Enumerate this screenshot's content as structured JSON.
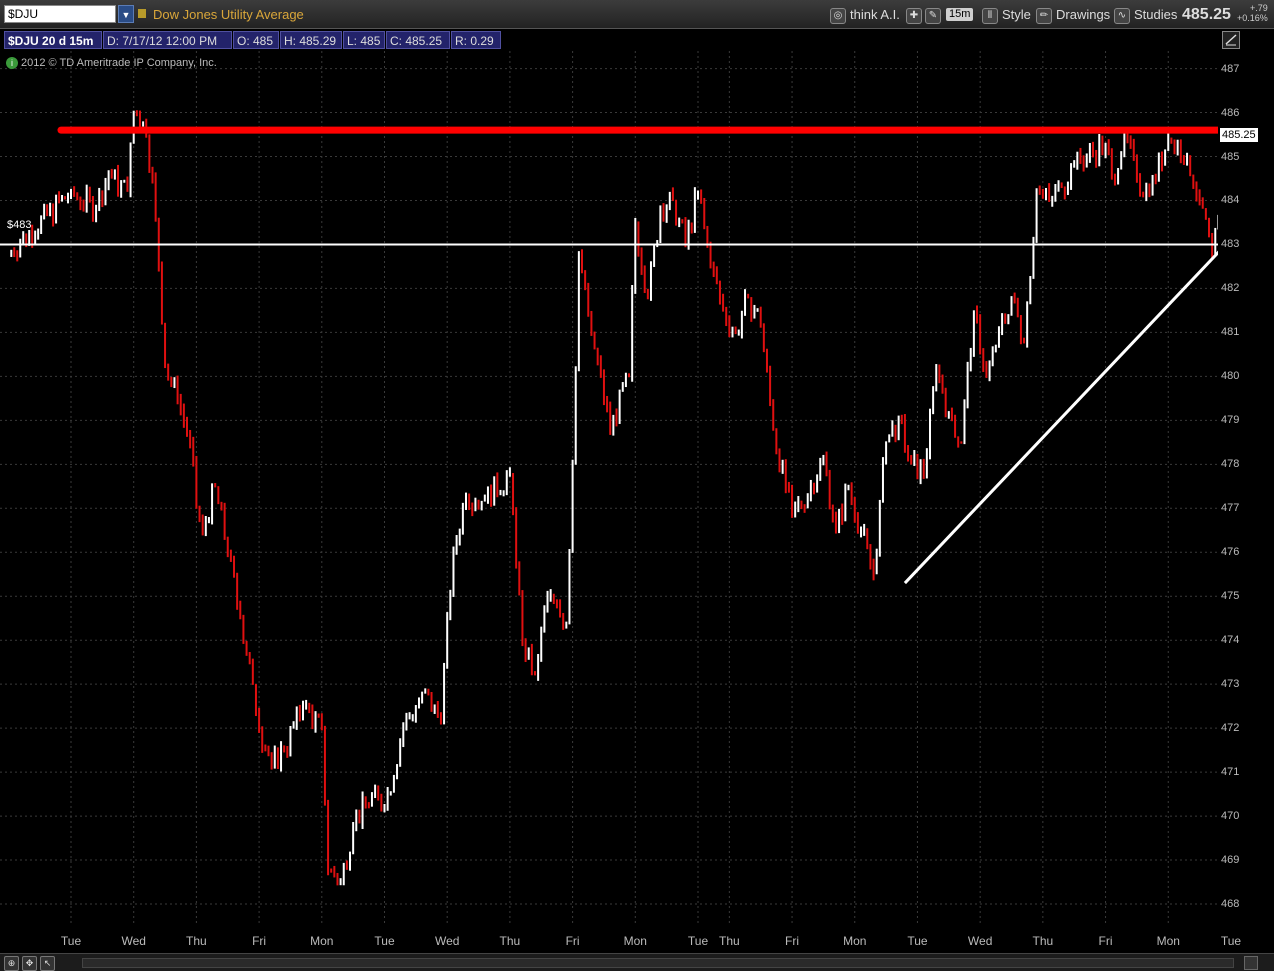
{
  "toolbar": {
    "symbol": "$DJU",
    "symbol_dropdown_icon": "chevron-down-icon",
    "instrument_name": "Dow Jones Utility Average",
    "think_ai": "think A.I.",
    "period": "15m",
    "style_label": "Style",
    "drawings_label": "Drawings",
    "studies_label": "Studies",
    "last_price": "485.25",
    "net_change": "+.79",
    "net_change_pct": "+0.16%"
  },
  "info": {
    "symbol_period": "$DJU 20 d 15m",
    "date": "D: 7/17/12 12:00 PM",
    "open": "O: 485",
    "high": "H: 485.29",
    "low": "L: 485",
    "close": "C: 485.25",
    "range": "R: 0.29"
  },
  "copyright": "2012 © TD Ameritrade IP Company, Inc.",
  "chart_data": {
    "type": "line",
    "interval": "15m",
    "last_price_label": "485.25",
    "horizontal_level_label": "$483",
    "horizontal_level": 483,
    "colors": {
      "up": "#ffffff",
      "down": "#e01010",
      "level": "#ffffff",
      "resistance_arrow": "#ff0000",
      "trendline": "#ffffff",
      "grid": "#3a3a3a",
      "background": "#000000"
    },
    "ylim": [
      467.5,
      487.4
    ],
    "y_ticks": [
      "487",
      "486",
      "485",
      "484",
      "483",
      "482",
      "481",
      "480",
      "479",
      "478",
      "477",
      "476",
      "475",
      "474",
      "473",
      "472",
      "471",
      "470",
      "469",
      "468"
    ],
    "x_ticks": [
      "Tue",
      "Wed",
      "Thu",
      "Fri",
      "Mon",
      "Tue",
      "Wed",
      "Thu",
      "Fri",
      "Mon",
      "Tue",
      "Thu",
      "Fri",
      "Mon",
      "Tue",
      "Wed",
      "Thu",
      "Fri",
      "Mon",
      "Tue"
    ],
    "x_tick_positions": [
      0,
      1,
      2,
      3,
      4,
      5,
      6,
      7,
      8,
      9,
      10,
      10.5,
      11.5,
      12.5,
      13.5,
      14.5,
      15.5,
      16.5,
      17.5,
      18.5
    ],
    "series": [
      {
        "x": [
          -1,
          0,
          0.4,
          0.6,
          0.9,
          1.0,
          1.15,
          1.3,
          1.5,
          1.7,
          1.9,
          2.0,
          2.1,
          2.3,
          2.5,
          2.7,
          2.9,
          3.0,
          3.2,
          3.4,
          3.7,
          4.0,
          4.1,
          4.3,
          4.5,
          4.8,
          5.0,
          5.3,
          5.6,
          5.9,
          6.0,
          6.1,
          6.3,
          6.6,
          7.0,
          7.2,
          7.4,
          7.6,
          7.9,
          8.0,
          8.1,
          8.3,
          8.6,
          8.9,
          9.0,
          9.2,
          9.4,
          9.6,
          9.8,
          10.0,
          10.2,
          10.4,
          10.6,
          10.8,
          11.0,
          11.2,
          11.5,
          11.8,
          12.0,
          12.2,
          12.4,
          12.6,
          12.8,
          13.0,
          13.2,
          13.4,
          13.6,
          13.8,
          14.0,
          14.2,
          14.4,
          14.6,
          14.8,
          15.0,
          15.2,
          15.4,
          15.6,
          15.8,
          16.0,
          16.2,
          16.5,
          16.6,
          16.8,
          17.0,
          17.2,
          17.5,
          17.8,
          18.0,
          18.2,
          18.4,
          18.6,
          18.8
        ],
        "y": [
          482.8,
          484.2,
          483.8,
          484.6,
          484.2,
          486.0,
          485.8,
          484.5,
          480.2,
          479.5,
          478.5,
          477.0,
          476.5,
          477.5,
          476.0,
          474.5,
          473.0,
          472.0,
          471.2,
          471.5,
          472.5,
          472.0,
          468.8,
          468.5,
          469.8,
          470.5,
          470.2,
          472.0,
          472.8,
          472.2,
          474.5,
          476.0,
          477.3,
          477.2,
          477.8,
          474.0,
          473.2,
          475.0,
          474.4,
          478.0,
          482.8,
          481.0,
          478.8,
          480.0,
          483.5,
          481.8,
          483.8,
          484.0,
          483.0,
          484.2,
          482.5,
          481.5,
          481.0,
          481.8,
          481.2,
          478.8,
          476.8,
          477.5,
          478.2,
          476.5,
          477.5,
          476.5,
          475.5,
          478.5,
          479.0,
          478.0,
          477.8,
          480.2,
          479.2,
          478.5,
          481.5,
          480.0,
          481.0,
          481.8,
          480.8,
          484.2,
          484.0,
          484.3,
          484.8,
          485.0,
          485.3,
          484.5,
          485.5,
          484.5,
          484.2,
          485.4,
          485.0,
          484.0,
          482.8,
          484.2,
          485.25,
          485.25
        ]
      }
    ],
    "annotations": [
      {
        "type": "arrow",
        "color": "#ff0000",
        "x1": 0,
        "y1": 485.6,
        "x2": 18.75,
        "y2": 485.6
      },
      {
        "type": "trendline",
        "color": "#ffffff",
        "x1": 13.3,
        "y1": 475.3,
        "x2": 18.75,
        "y2": 483.5
      }
    ]
  },
  "status_bar": {
    "icons": [
      "zoom-icon",
      "pan-icon",
      "cursor-icon"
    ]
  }
}
